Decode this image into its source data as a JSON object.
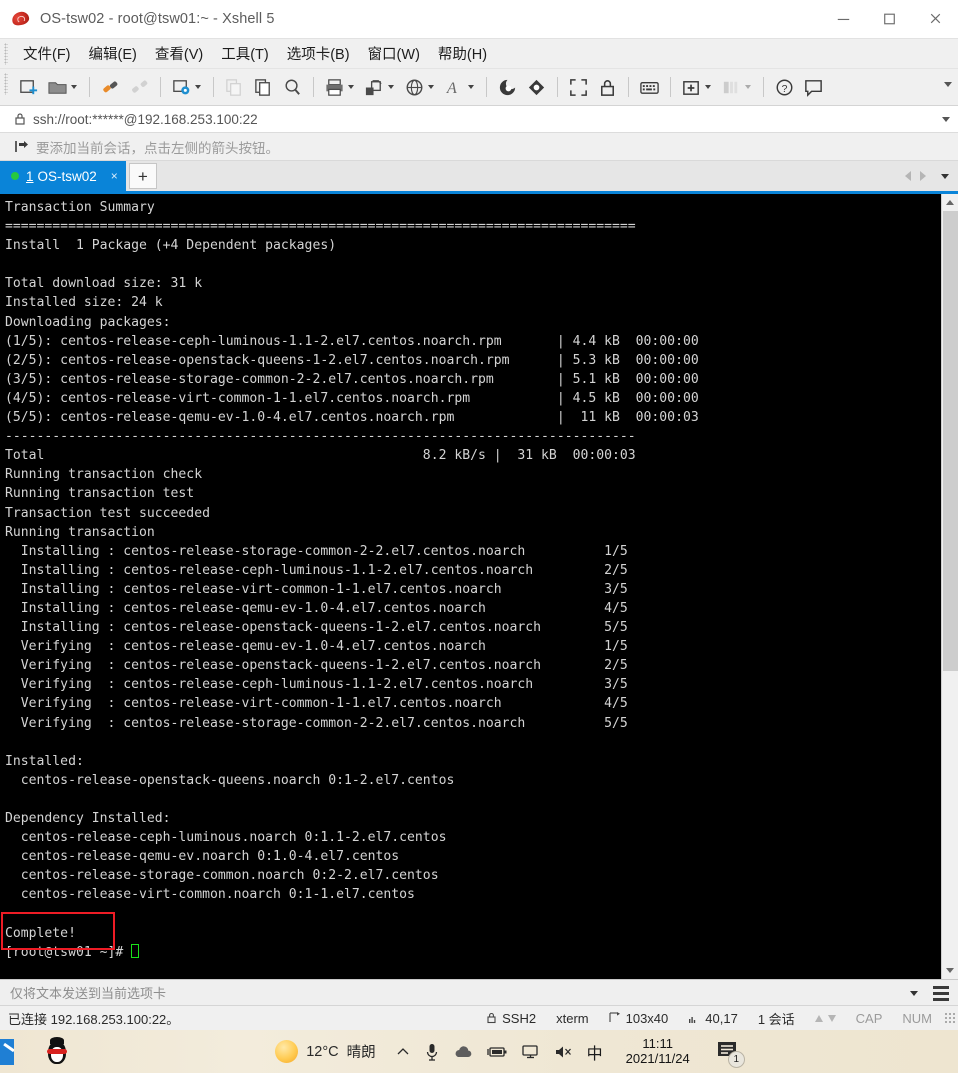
{
  "window": {
    "title": "OS-tsw02 - root@tsw01:~ - Xshell 5",
    "app_icon": "xshell-icon",
    "controls": {
      "minimize": "minimize-button",
      "maximize": "maximize-button",
      "close": "close-button"
    }
  },
  "menubar": {
    "items": [
      {
        "label": "文件(F)",
        "name": "menu-file"
      },
      {
        "label": "编辑(E)",
        "name": "menu-edit"
      },
      {
        "label": "查看(V)",
        "name": "menu-view"
      },
      {
        "label": "工具(T)",
        "name": "menu-tools"
      },
      {
        "label": "选项卡(B)",
        "name": "menu-tabs"
      },
      {
        "label": "窗口(W)",
        "name": "menu-window"
      },
      {
        "label": "帮助(H)",
        "name": "menu-help"
      }
    ]
  },
  "toolbar": {
    "icons": [
      "new-session-icon",
      "open-folder-icon",
      "folder-dropdown-caret",
      "separator",
      "connect-icon",
      "disconnect-icon",
      "separator",
      "session-properties-icon",
      "properties-dropdown-caret",
      "separator",
      "copy-disabled-icon",
      "paste-icon",
      "find-icon",
      "separator",
      "print-icon",
      "print-dropdown-caret",
      "transfer-file-icon",
      "transfer-dropdown-caret",
      "globe-icon",
      "globe-dropdown-caret",
      "font-icon",
      "font-dropdown-caret",
      "separator",
      "xftp-icon",
      "xagent-icon",
      "separator",
      "fullscreen-icon",
      "lock-icon",
      "separator",
      "keyboard-icon",
      "separator",
      "add-to-folder-icon",
      "add-dropdown-caret",
      "layout-icon",
      "layout-dropdown-caret",
      "separator",
      "help-icon",
      "feedback-icon"
    ],
    "overflow": "toolbar-overflow-caret"
  },
  "address_bar": {
    "lock_icon": "lock-icon",
    "value": "ssh://root:******@192.168.253.100:22",
    "dropdown": "address-dropdown-caret"
  },
  "hint_bar": {
    "icon": "add-session-arrow-icon",
    "text": "要添加当前会话，点击左侧的箭头按钮。"
  },
  "tabs": {
    "items": [
      {
        "status": "connected",
        "number": "1",
        "label": "OS-tsw02",
        "close": "×"
      }
    ],
    "new_tab_label": "+",
    "nav_prev": "tab-prev-arrow",
    "nav_next": "tab-next-arrow",
    "nav_list": "tab-list-caret"
  },
  "terminal": {
    "lines": [
      "Transaction Summary",
      "================================================================================",
      "Install  1 Package (+4 Dependent packages)",
      "",
      "Total download size: 31 k",
      "Installed size: 24 k",
      "Downloading packages:",
      "(1/5): centos-release-ceph-luminous-1.1-2.el7.centos.noarch.rpm       | 4.4 kB  00:00:00",
      "(2/5): centos-release-openstack-queens-1-2.el7.centos.noarch.rpm      | 5.3 kB  00:00:00",
      "(3/5): centos-release-storage-common-2-2.el7.centos.noarch.rpm        | 5.1 kB  00:00:00",
      "(4/5): centos-release-virt-common-1-1.el7.centos.noarch.rpm           | 4.5 kB  00:00:00",
      "(5/5): centos-release-qemu-ev-1.0-4.el7.centos.noarch.rpm             |  11 kB  00:00:03",
      "--------------------------------------------------------------------------------",
      "Total                                                8.2 kB/s |  31 kB  00:00:03",
      "Running transaction check",
      "Running transaction test",
      "Transaction test succeeded",
      "Running transaction",
      "  Installing : centos-release-storage-common-2-2.el7.centos.noarch          1/5",
      "  Installing : centos-release-ceph-luminous-1.1-2.el7.centos.noarch         2/5",
      "  Installing : centos-release-virt-common-1-1.el7.centos.noarch             3/5",
      "  Installing : centos-release-qemu-ev-1.0-4.el7.centos.noarch               4/5",
      "  Installing : centos-release-openstack-queens-1-2.el7.centos.noarch        5/5",
      "  Verifying  : centos-release-qemu-ev-1.0-4.el7.centos.noarch               1/5",
      "  Verifying  : centos-release-openstack-queens-1-2.el7.centos.noarch        2/5",
      "  Verifying  : centos-release-ceph-luminous-1.1-2.el7.centos.noarch         3/5",
      "  Verifying  : centos-release-virt-common-1-1.el7.centos.noarch             4/5",
      "  Verifying  : centos-release-storage-common-2-2.el7.centos.noarch          5/5",
      "",
      "Installed:",
      "  centos-release-openstack-queens.noarch 0:1-2.el7.centos",
      "",
      "Dependency Installed:",
      "  centos-release-ceph-luminous.noarch 0:1.1-2.el7.centos",
      "  centos-release-qemu-ev.noarch 0:1.0-4.el7.centos",
      "  centos-release-storage-common.noarch 0:2-2.el7.centos",
      "  centos-release-virt-common.noarch 0:1-1.el7.centos",
      "",
      "Complete!"
    ],
    "prompt": "[root@tsw01 ~]# ",
    "cursor": "block-cursor",
    "annotation_color": "#ee1c25",
    "cursor_color": "#19e019",
    "background": "#000000",
    "foreground": "#d4d4d4"
  },
  "send_bar": {
    "placeholder": "仅将文本发送到当前选项卡",
    "value": "",
    "dropdown": "send-dropdown-caret",
    "menu": "send-options-menu"
  },
  "status_bar": {
    "connection": "已连接 192.168.253.100:22。",
    "protocol": "SSH2",
    "terminal_type": "xterm",
    "size": "103x40",
    "cursor_position": "40,17",
    "sessions": "1 会话",
    "cap": "CAP",
    "num": "NUM"
  },
  "taskbar": {
    "start": "start-button",
    "pinned": [
      {
        "name": "qq-icon"
      }
    ],
    "weather_temp": "12°C",
    "weather_desc": "晴朗",
    "tray": [
      "chevron-up-icon",
      "microphone-icon",
      "onedrive-icon",
      "battery-icon",
      "network-icon",
      "volume-muted-icon"
    ],
    "ime": "中",
    "time": "11:11",
    "date": "2021/11/24",
    "notification_count": "1"
  }
}
